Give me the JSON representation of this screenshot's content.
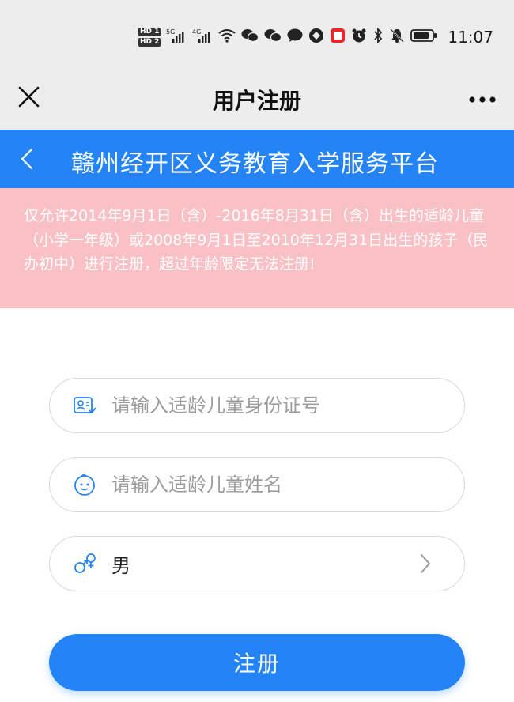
{
  "status_bar": {
    "hd1": "HD 1",
    "hd2": "HD 2",
    "net1": "5G",
    "net2": "4G",
    "time": "11:07"
  },
  "titlebar": {
    "title": "用户注册",
    "close_icon": "close-icon",
    "more_icon": "more-icon"
  },
  "header": {
    "title": "赣州经开区义务教育入学服务平台",
    "back_icon": "back-icon"
  },
  "notice": {
    "text": "仅允许2014年9月1日（含）-2016年8月31日（含）出生的适龄儿童（小学一年级）或2008年9月1日至2010年12月31日出生的孩子（民办初中）进行注册，超过年龄限定无法注册!"
  },
  "form": {
    "id_placeholder": "请输入适龄儿童身份证号",
    "name_placeholder": "请输入适龄儿童姓名",
    "gender_value": "男",
    "submit_label": "注册"
  },
  "colors": {
    "accent": "#2584f5",
    "notice_bg": "#f9c0c5",
    "bar_bg": "#ededed"
  }
}
